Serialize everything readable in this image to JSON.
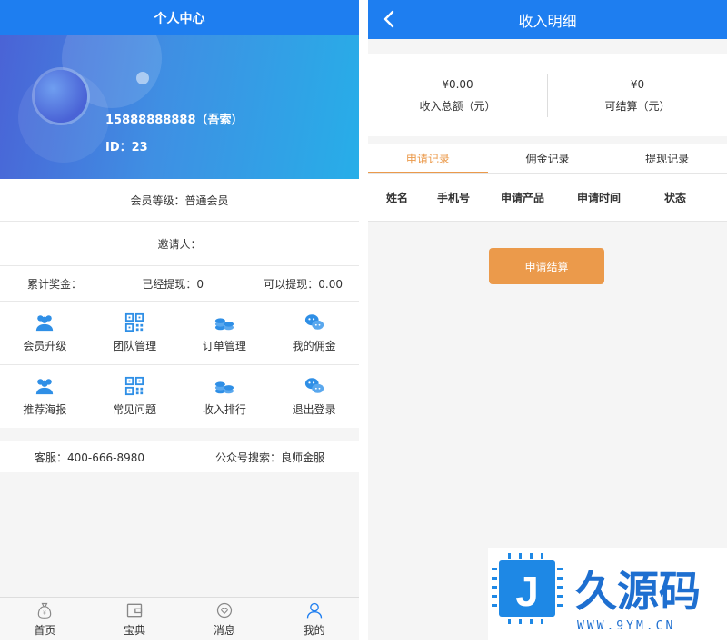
{
  "left": {
    "title": "个人中心",
    "profile": {
      "phone": "15888888888（吾索）",
      "id": "ID：23"
    },
    "member_level": "会员等级：普通会员",
    "inviter": "邀请人：",
    "stats": {
      "total": "累计奖金：",
      "withdrawn": "已经提现：0",
      "available": "可以提现：0.00"
    },
    "menu": [
      {
        "label": "会员升级",
        "icon": "user-group-icon"
      },
      {
        "label": "团队管理",
        "icon": "qrcode-icon"
      },
      {
        "label": "订单管理",
        "icon": "coins-icon"
      },
      {
        "label": "我的佣金",
        "icon": "wechat-icon"
      },
      {
        "label": "推荐海报",
        "icon": "user-group-icon"
      },
      {
        "label": "常见问题",
        "icon": "qrcode-icon"
      },
      {
        "label": "收入排行",
        "icon": "coins-icon"
      },
      {
        "label": "退出登录",
        "icon": "wechat-icon"
      }
    ],
    "service": {
      "phone": "客服：400-666-8980",
      "wechat": "公众号搜索：良师金服"
    },
    "nav": [
      {
        "label": "首页",
        "icon": "money-bag-icon"
      },
      {
        "label": "宝典",
        "icon": "wallet-icon"
      },
      {
        "label": "消息",
        "icon": "heart-chat-icon"
      },
      {
        "label": "我的",
        "icon": "person-icon"
      }
    ]
  },
  "right": {
    "title": "收入明细",
    "summary": [
      {
        "value": "¥0.00",
        "label": "收入总额（元）"
      },
      {
        "value": "¥0",
        "label": "可结算（元）"
      }
    ],
    "tabs": [
      "申请记录",
      "佣金记录",
      "提现记录"
    ],
    "columns": [
      "姓名",
      "手机号",
      "申请产品",
      "申请时间",
      "状态"
    ],
    "apply_button": "申请结算"
  },
  "watermark": {
    "logo_letter": "J",
    "name": "久源码",
    "url": "WWW.9YM.CN"
  },
  "colors": {
    "primary": "#1e7ef0",
    "accent": "#eb9a4b",
    "icon": "#2f8fe6"
  }
}
